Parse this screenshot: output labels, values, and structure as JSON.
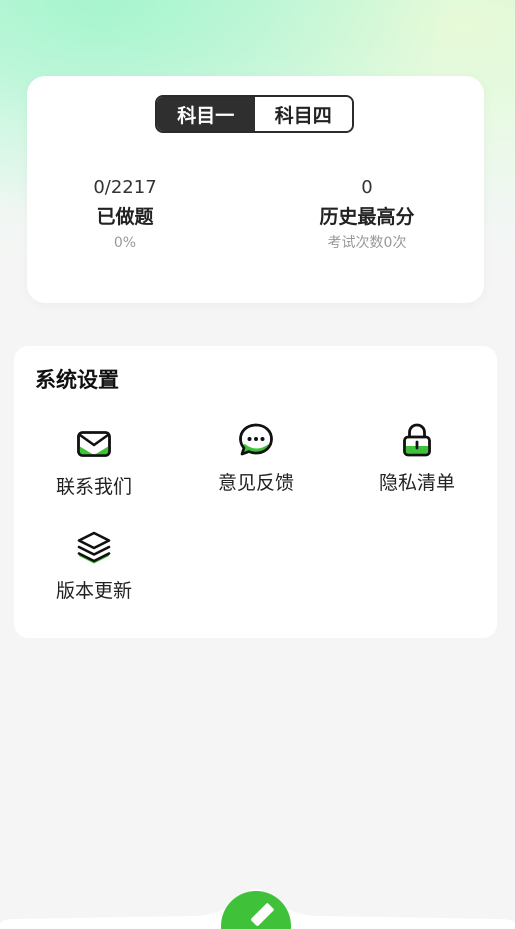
{
  "subjects": {
    "tab1": "科目一",
    "tab4": "科目四",
    "active": "tab1"
  },
  "stats": {
    "done": {
      "value": "0/2217",
      "label": "已做题",
      "sub": "0%"
    },
    "best": {
      "value": "0",
      "label": "历史最高分",
      "sub": "考试次数0次"
    }
  },
  "settings": {
    "title": "系统设置",
    "items": [
      {
        "label": "联系我们",
        "icon": "mail-icon"
      },
      {
        "label": "意见反馈",
        "icon": "chat-bubble-icon"
      },
      {
        "label": "隐私清单",
        "icon": "lock-icon"
      },
      {
        "label": "版本更新",
        "icon": "layers-icon"
      }
    ]
  },
  "nav": {
    "fab_icon": "pencil-icon"
  },
  "colors": {
    "accent": "#3fc23a",
    "dark": "#2f2f2f"
  }
}
